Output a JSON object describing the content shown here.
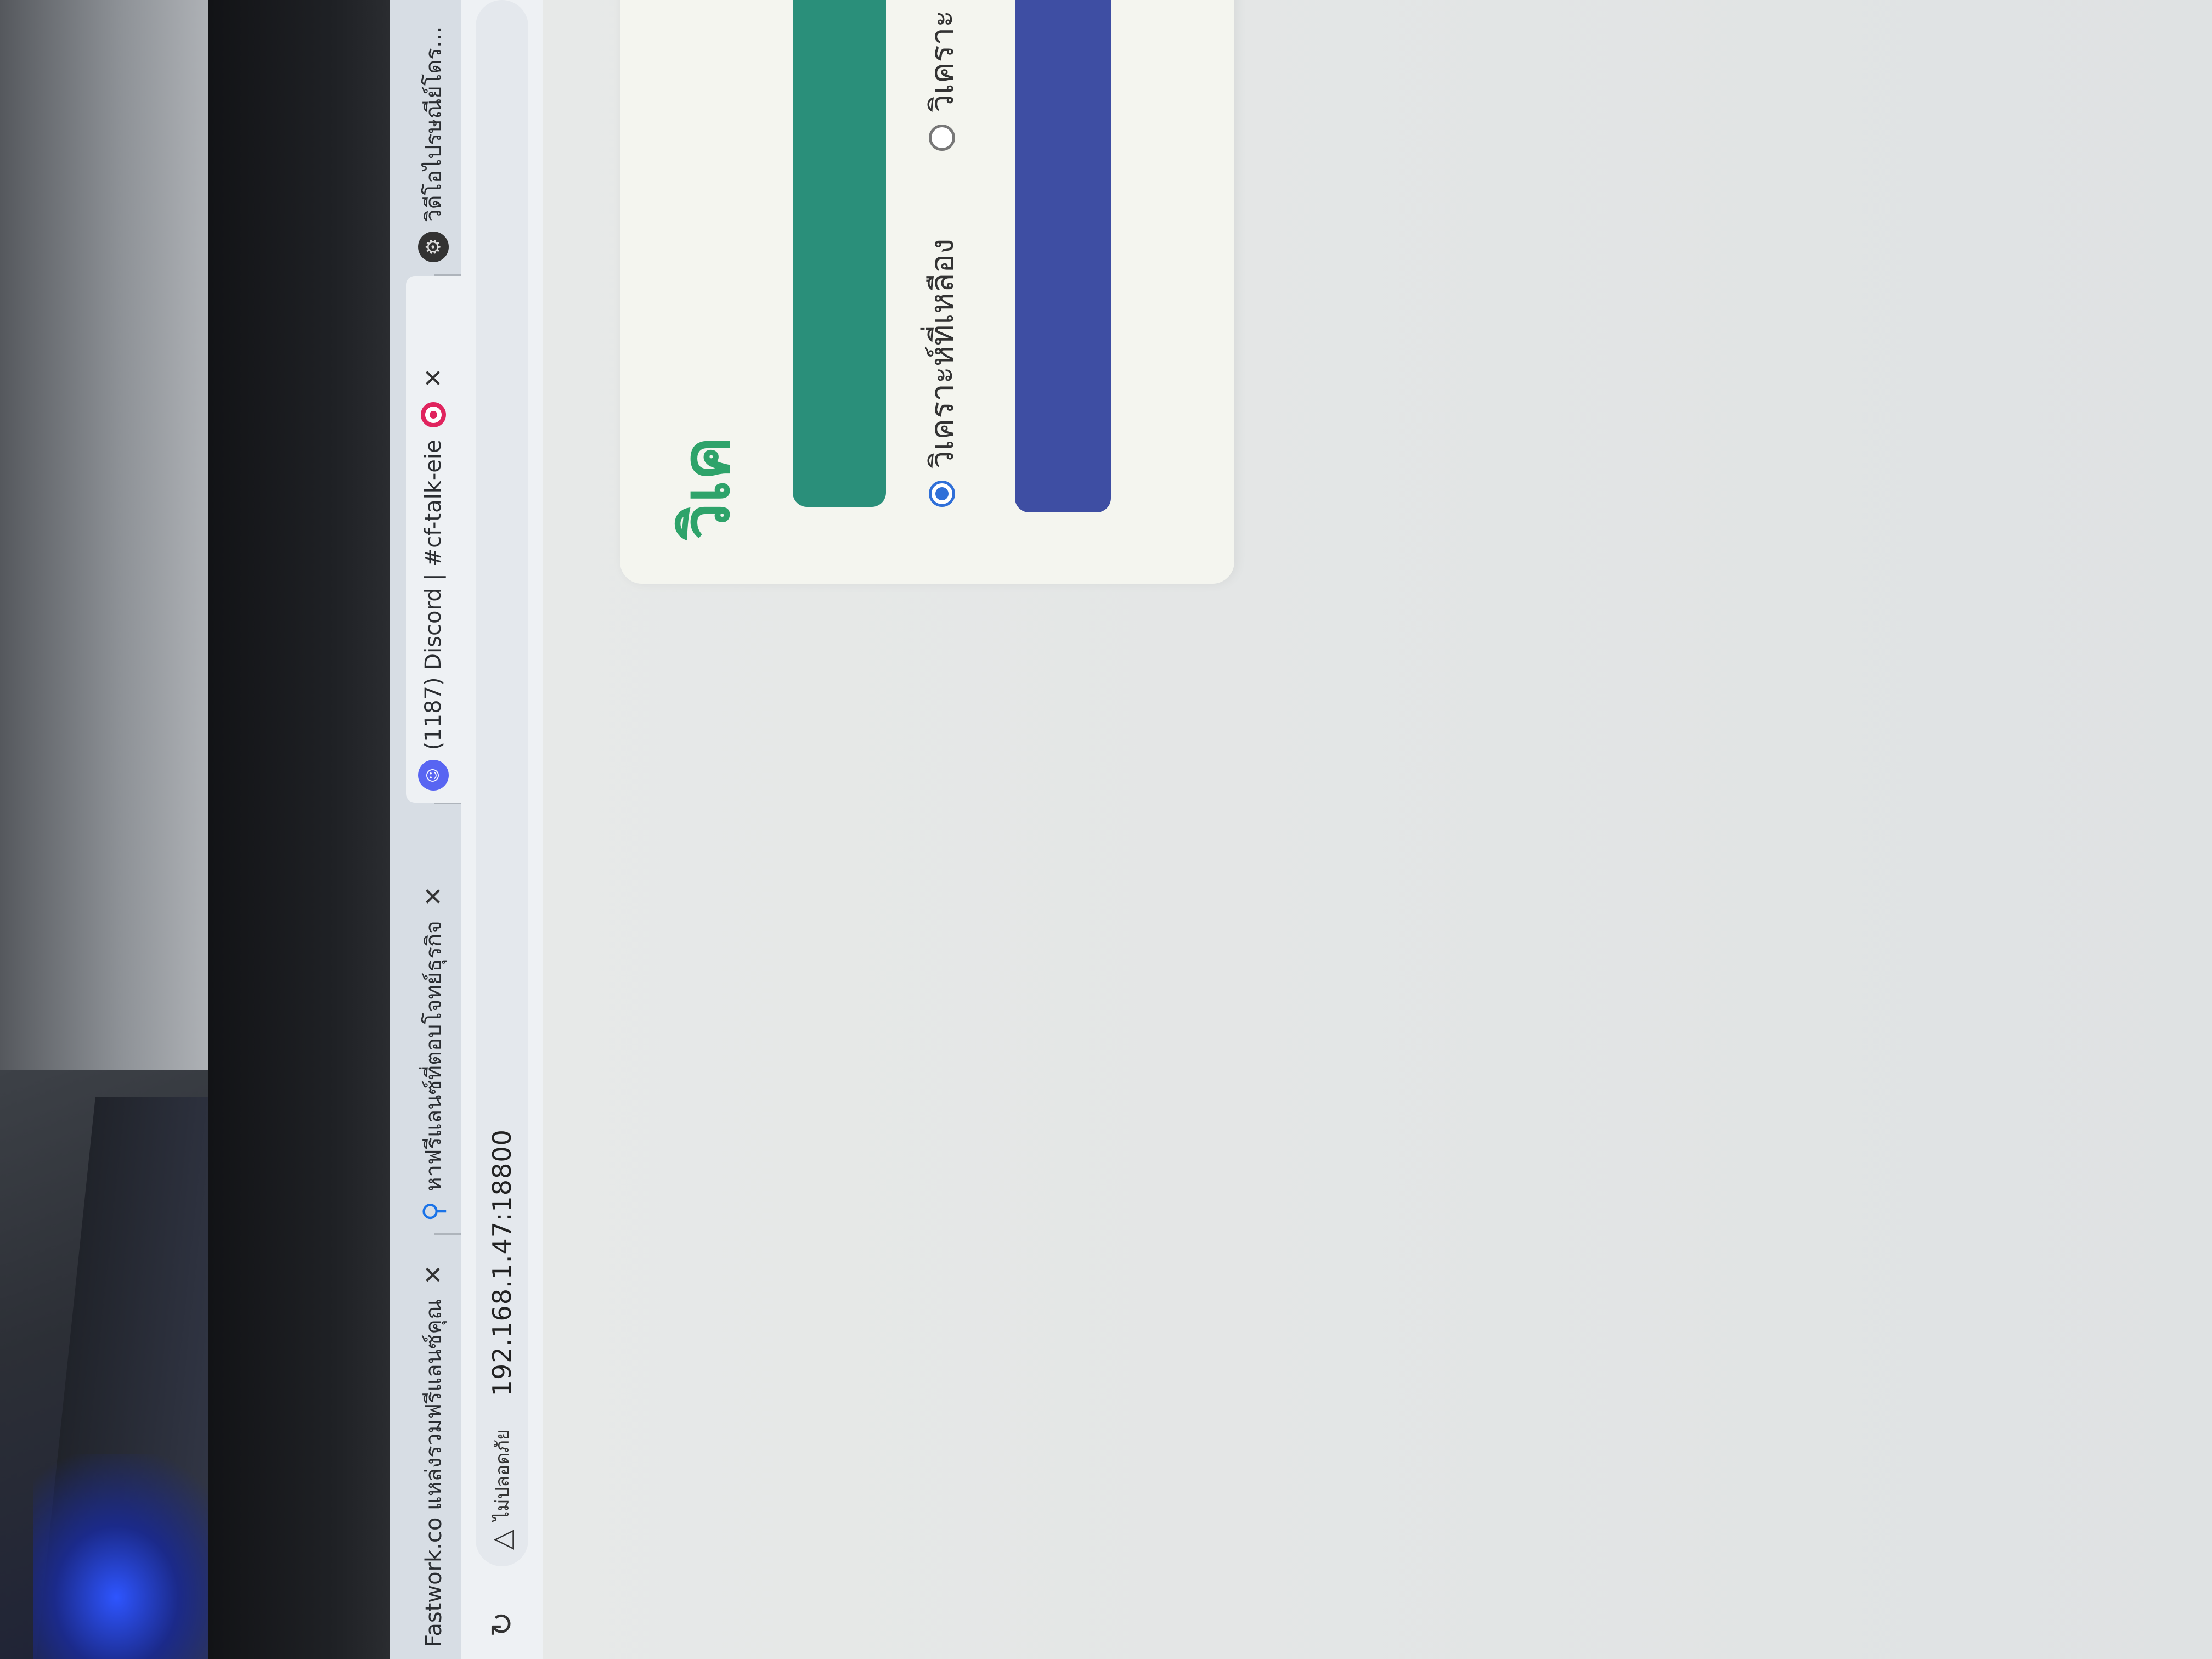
{
  "browser": {
    "tabs": [
      {
        "label": "Fastwork.co แหล่งรวมฟรีแลนซ์คุณ",
        "close": "✕"
      },
      {
        "label": "หาฟรีแลนซ์ที่ตอบโจทย์ธุรกิจ",
        "close": "✕"
      },
      {
        "label": "(1187) Discord | #cf-talk-eie",
        "close": "✕"
      },
      {
        "label": "วิดีโอไปรษณีย์โดรจ้ำง"
      }
    ],
    "not_secure_label": "ไม่ปลอดภัย",
    "url": "192.168.1.47:18800"
  },
  "icons": {
    "reload": "reload-icon",
    "warning": "warning-triangle-icon",
    "discord_favicon": "discord-favicon-icon",
    "people_favicon": "people-favicon-icon",
    "recording": "recording-indicator-icon",
    "gear_favicon": "gear-favicon-icon"
  },
  "main": {
    "title": "วิเค",
    "options": [
      {
        "label": "วิเคราะห์ที่เหลือง",
        "selected": true
      },
      {
        "label": "วิเคราะ",
        "selected": false
      }
    ]
  },
  "colors": {
    "title": "#2ea36a",
    "primary_button": "#2a8f7a",
    "secondary_button": "#3e4ea3",
    "radio_selected": "#2f6fd8"
  }
}
